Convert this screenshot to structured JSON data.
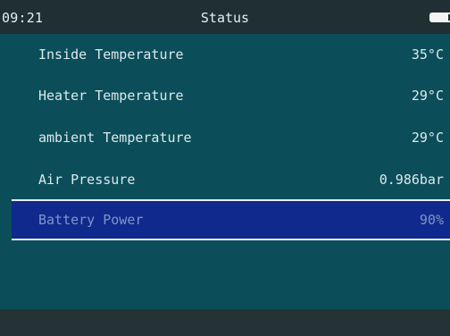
{
  "status_bar": {
    "time": "09:21",
    "title": "Status"
  },
  "items": [
    {
      "label": "Inside Temperature",
      "value": "35°C"
    },
    {
      "label": "Heater Temperature",
      "value": "29°C"
    },
    {
      "label": "ambient Temperature",
      "value": "29°C"
    },
    {
      "label": "Air Pressure",
      "value": "0.986bar"
    },
    {
      "label": "Battery Power",
      "value": "90%",
      "selected": true
    }
  ],
  "colors": {
    "background": "#0b4e59",
    "status_bar": "#1f2f33",
    "selected_row": "#10298c",
    "selected_text": "#7f96c8"
  },
  "icons": {
    "battery": "battery-icon"
  }
}
